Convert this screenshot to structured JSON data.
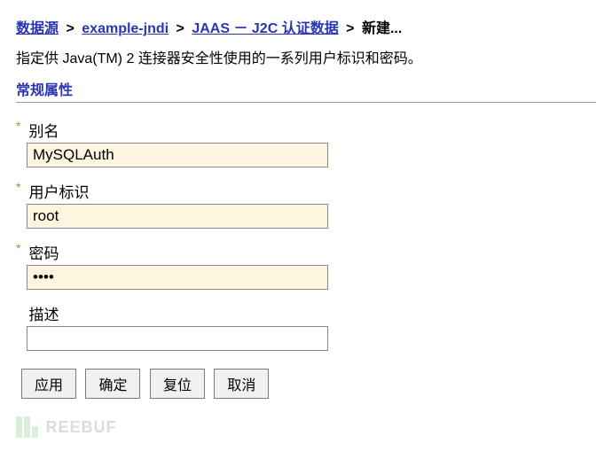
{
  "breadcrumb": {
    "items": [
      {
        "label": "数据源",
        "link": true
      },
      {
        "label": "example-jndi",
        "link": true
      },
      {
        "label": "JAAS － J2C 认证数据",
        "link": true
      },
      {
        "label": "新建...",
        "link": false
      }
    ],
    "sep": ">"
  },
  "description": "指定供 Java(TM) 2 连接器安全性使用的一系列用户标识和密码。",
  "section_title": "常规属性",
  "fields": {
    "alias": {
      "label": "别名",
      "value": "MySQLAuth",
      "required": true,
      "type": "text"
    },
    "userid": {
      "label": "用户标识",
      "value": "root",
      "required": true,
      "type": "text"
    },
    "password": {
      "label": "密码",
      "value": "••••",
      "required": true,
      "type": "password"
    },
    "desc": {
      "label": "描述",
      "value": "",
      "required": false,
      "type": "text"
    }
  },
  "buttons": {
    "apply": "应用",
    "ok": "确定",
    "reset": "复位",
    "cancel": "取消"
  },
  "watermark": "REEBUF"
}
